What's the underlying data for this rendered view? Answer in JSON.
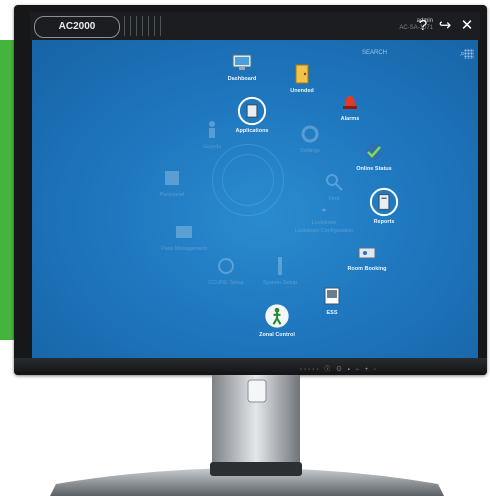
{
  "brand": "AC2000",
  "user": {
    "name": "admin",
    "host": "AC-SA-1071"
  },
  "search": {
    "placeholder": "SEARCH"
  },
  "topbar_buttons": {
    "help": "?",
    "logout": "↪",
    "close": "✕"
  },
  "menu_active": [
    {
      "label": "Dashboard",
      "icon": "dashboard-icon"
    },
    {
      "label": "Unended",
      "icon": "door-icon"
    },
    {
      "label": "Alarms",
      "icon": "alarm-icon"
    },
    {
      "label": "Applications",
      "icon": "applications-icon"
    },
    {
      "label": "Online Status",
      "icon": "online-status-icon"
    },
    {
      "label": "Reports",
      "icon": "reports-icon"
    },
    {
      "label": "Room Booking",
      "icon": "room-booking-icon"
    },
    {
      "label": "ESS",
      "icon": "ess-icon"
    },
    {
      "label": "Zonal Control",
      "icon": "zonal-control-icon"
    }
  ],
  "menu_dim": [
    "Guards",
    "Settings",
    "Find",
    "Lockdown",
    "Lockdown Configuration",
    "System Setup",
    "CCURE Setup",
    "Pass Management",
    "Personnel"
  ],
  "monitor_controls": "◦◦◦◦◦ ⓘ ⊙ ▪ − + ◦",
  "colors": {
    "screen": "#1f78bf",
    "accent": "#45b43c",
    "bar": "#1b1d20"
  }
}
